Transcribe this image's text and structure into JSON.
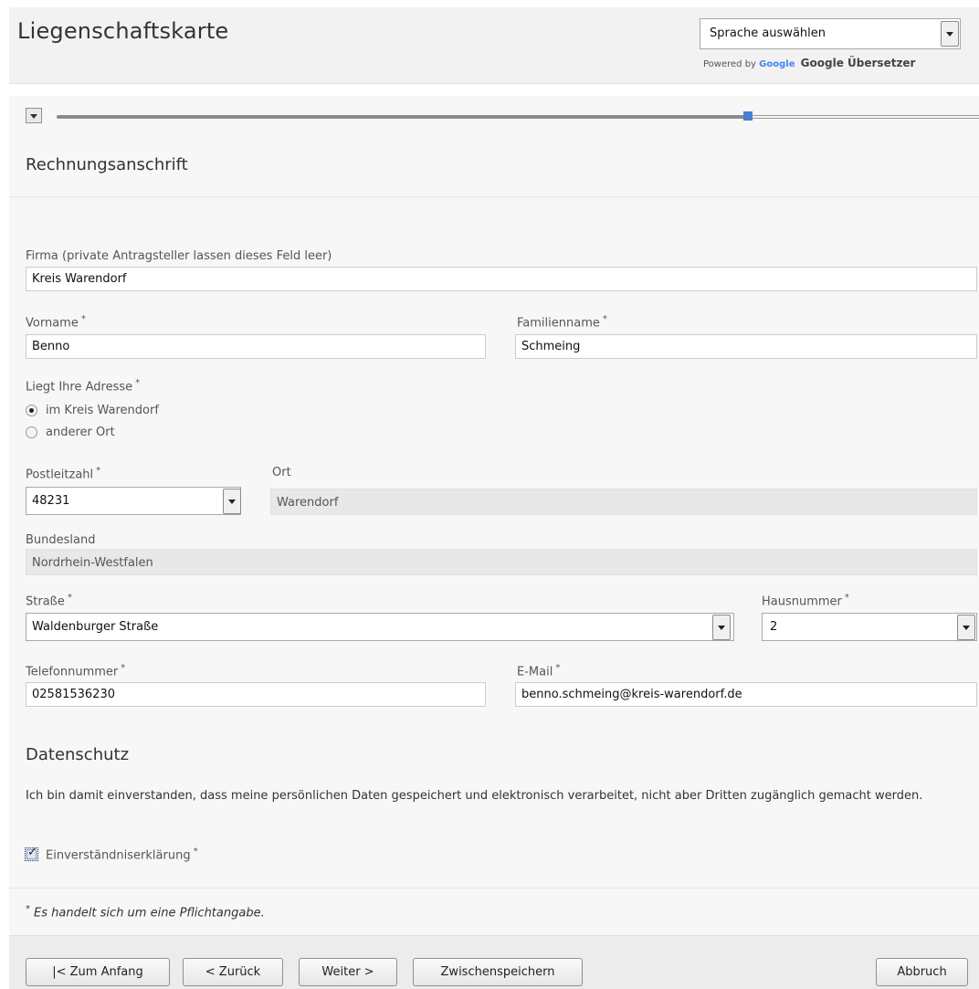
{
  "header": {
    "title": "Liegenschaftskarte",
    "language_select": {
      "value": "Sprache auswählen"
    },
    "powered_by": "Powered by",
    "google_logo_text": "Google",
    "translator": "Google Übersetzer"
  },
  "progress": {
    "fraction_complete": 0.77
  },
  "billing": {
    "section_title": "Rechnungsanschrift",
    "company": {
      "label": "Firma (private Antragsteller lassen dieses Feld leer)",
      "value": "Kreis Warendorf"
    },
    "first_name": {
      "label": "Vorname",
      "value": "Benno"
    },
    "last_name": {
      "label": "Familienname",
      "value": "Schmeing"
    },
    "address_location": {
      "label": "Liegt Ihre Adresse",
      "options": [
        "im Kreis Warendorf",
        "anderer Ort"
      ],
      "selected": "im Kreis Warendorf"
    },
    "postal_code": {
      "label": "Postleitzahl",
      "value": "48231"
    },
    "city": {
      "label": "Ort",
      "value": "Warendorf"
    },
    "state": {
      "label": "Bundesland",
      "value": "Nordrhein-Westfalen"
    },
    "street": {
      "label": "Straße",
      "value": "Waldenburger Straße"
    },
    "house_number": {
      "label": "Hausnummer",
      "value": "2"
    },
    "phone": {
      "label": "Telefonnummer",
      "value": "02581536230"
    },
    "email": {
      "label": "E-Mail",
      "value": "benno.schmeing@kreis-warendorf.de"
    },
    "required_marker": "*"
  },
  "privacy": {
    "section_title": "Datenschutz",
    "text": "Ich bin damit einverstanden, dass meine persönlichen Daten gespeichert und elektronisch verarbeitet, nicht aber Dritten zugänglich gemacht werden.",
    "consent_label": "Einverständniserklärung",
    "consent_checked": true
  },
  "footnote": "Es handelt sich um eine Pflichtangabe.",
  "buttons": {
    "first": "|< Zum Anfang",
    "back": "< Zurück",
    "next": "Weiter >",
    "save": "Zwischenspeichern",
    "cancel": "Abbruch"
  }
}
